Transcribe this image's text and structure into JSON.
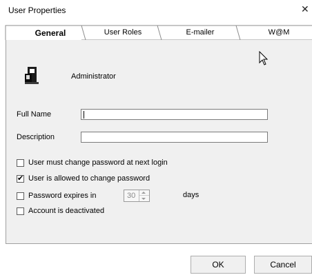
{
  "window": {
    "title": "User Properties",
    "close_glyph": "✕"
  },
  "tabs": [
    {
      "label": "General",
      "active": true
    },
    {
      "label": "User Roles",
      "active": false
    },
    {
      "label": "E-mailer",
      "active": false
    },
    {
      "label": "W@M",
      "active": false
    }
  ],
  "general": {
    "user_icon": "user-icon",
    "user_name": "Administrator",
    "full_name": {
      "label": "Full Name",
      "value": ""
    },
    "description": {
      "label": "Description",
      "value": ""
    },
    "options": {
      "must_change": {
        "label": "User must change password at next login",
        "checked": false
      },
      "allowed_change": {
        "label": "User is allowed to change password",
        "checked": true
      },
      "expires": {
        "label": "Password expires in",
        "checked": false
      },
      "deactivated": {
        "label": "Account is deactivated",
        "checked": false
      }
    },
    "expires_days": "30",
    "days_label": "days"
  },
  "footer": {
    "ok_label": "OK",
    "cancel_label": "Cancel"
  }
}
